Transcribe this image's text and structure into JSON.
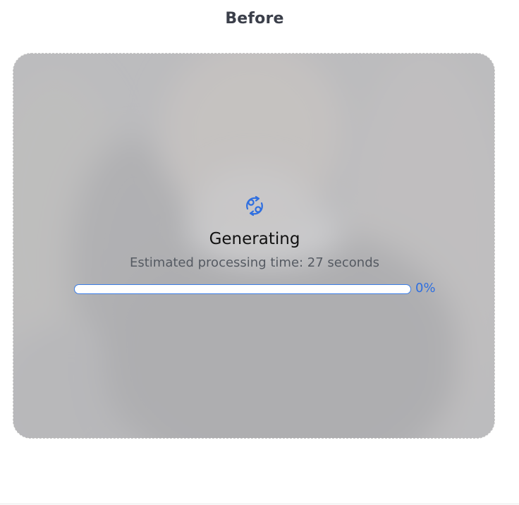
{
  "header": {
    "title": "Before"
  },
  "preview": {
    "status_icon": "sync-icon",
    "status_title": "Generating",
    "status_subtitle": "Estimated processing time: 27 seconds",
    "progress_percent": 0,
    "progress_label": "0%"
  },
  "colors": {
    "accent": "#3b7de6",
    "title_text": "#3b3f4a",
    "overlay": "#c4c4c6"
  }
}
